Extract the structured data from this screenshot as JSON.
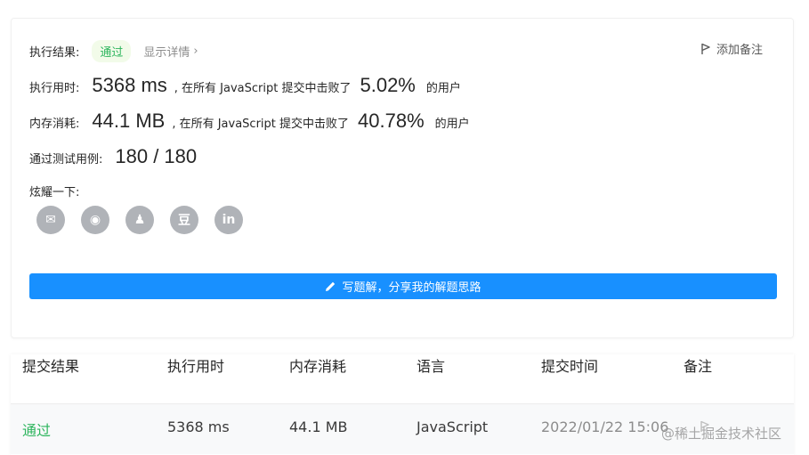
{
  "result": {
    "label": "执行结果:",
    "status": "通过",
    "detail_link": "显示详情",
    "add_note": "添加备注"
  },
  "runtime": {
    "label": "执行用时:",
    "value": "5368 ms",
    "middle": ", 在所有 JavaScript 提交中击败了",
    "percent": "5.02%",
    "suffix": "的用户"
  },
  "memory": {
    "label": "内存消耗:",
    "value": "44.1 MB",
    "middle": ", 在所有 JavaScript 提交中击败了",
    "percent": "40.78%",
    "suffix": "的用户"
  },
  "tests": {
    "label": "通过测试用例:",
    "value": "180 / 180"
  },
  "share": {
    "label": "炫耀一下:",
    "buttons": [
      {
        "icon": "wechat-icon",
        "glyph": "✉"
      },
      {
        "icon": "weibo-icon",
        "glyph": "◉"
      },
      {
        "icon": "qq-icon",
        "glyph": "♟"
      },
      {
        "icon": "douban-icon",
        "glyph": "豆"
      },
      {
        "icon": "linkedin-icon",
        "glyph": "in"
      }
    ]
  },
  "write_solution": {
    "label": "写题解，分享我的解题思路"
  },
  "table": {
    "headers": [
      "提交结果",
      "执行用时",
      "内存消耗",
      "语言",
      "提交时间",
      "备注"
    ],
    "rows": [
      {
        "result": "通过",
        "runtime": "5368 ms",
        "memory": "44.1 MB",
        "language": "JavaScript",
        "time": "2022/01/22 15:06"
      }
    ]
  },
  "watermark": "@稀土掘金技术社区",
  "colors": {
    "accent": "#1890ff",
    "success": "#2db55d",
    "icon_gray": "#b0b3b8"
  }
}
